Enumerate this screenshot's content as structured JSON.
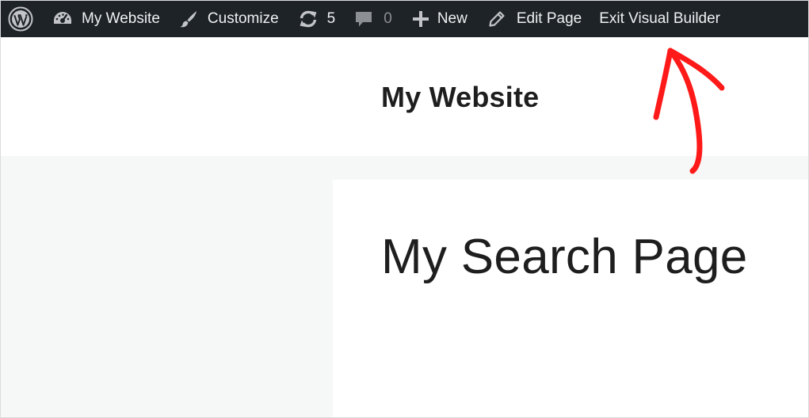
{
  "admin_bar": {
    "site_name": "My Website",
    "customize_label": "Customize",
    "updates_count": "5",
    "comments_count": "0",
    "new_label": "New",
    "edit_page_label": "Edit Page",
    "exit_builder_label": "Exit Visual Builder",
    "icons": {
      "wordpress": "wordpress-logo-icon",
      "site": "dashboard-icon",
      "customize": "brush-icon",
      "updates": "refresh-icon",
      "comments": "comment-bubble-icon",
      "new": "plus-icon",
      "edit": "pencil-icon"
    }
  },
  "header": {
    "site_title": "My Website"
  },
  "content": {
    "page_title": "My Search Page"
  },
  "colors": {
    "admin_bar_bg": "#1d2327",
    "admin_bar_text": "#f0f0f1",
    "page_bg": "#f6f7f7",
    "annotation": "#ff1a1a"
  }
}
